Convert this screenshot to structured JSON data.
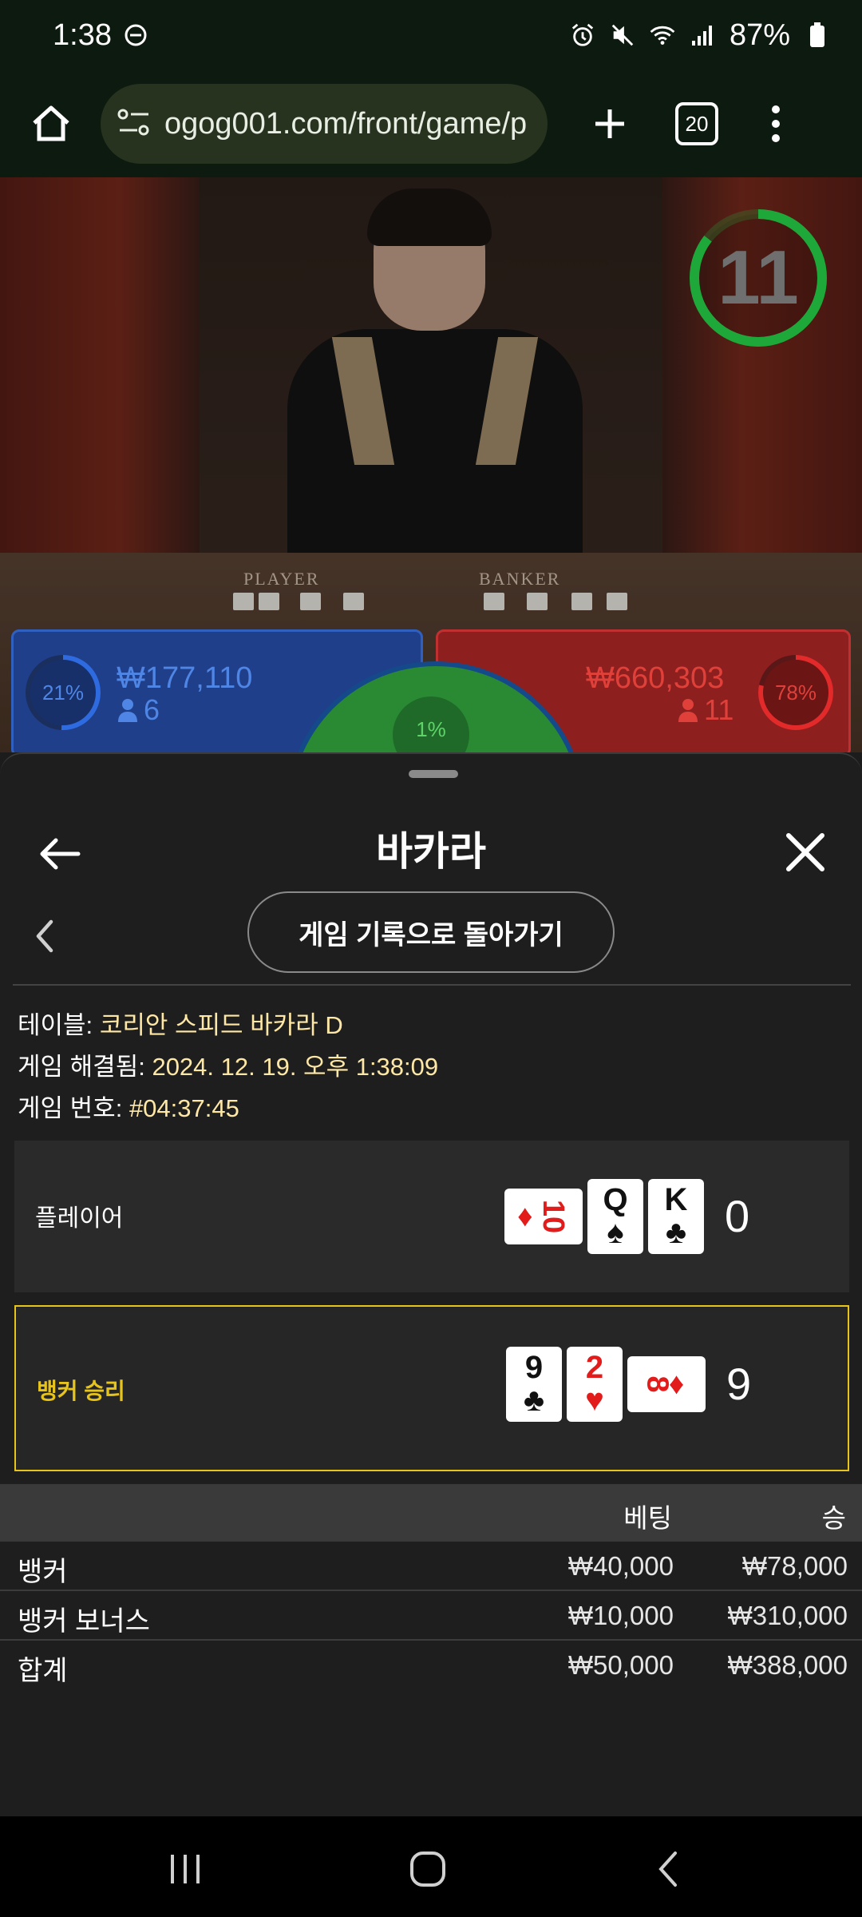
{
  "status_bar": {
    "time": "1:38",
    "battery": "87%"
  },
  "browser": {
    "url": "ogog001.com/front/game/p",
    "tab_count": "20"
  },
  "video": {
    "timer": "11",
    "player_label": "PLAYER",
    "banker_label": "BANKER"
  },
  "betting_board": {
    "player_pct": "21%",
    "player_amount": "₩177,110",
    "player_count": "6",
    "tie_pct": "1%",
    "banker_amount": "₩660,303",
    "banker_count": "11",
    "banker_pct": "78%"
  },
  "sheet": {
    "title": "바카라",
    "return_button": "게임 기록으로 돌아가기",
    "table_label": "테이블:",
    "table_value": "코리안 스피드 바카라 D",
    "resolved_label": "게임 해결됨:",
    "resolved_value": "2024. 12. 19. 오후 1:38:09",
    "game_no_label": "게임 번호:",
    "game_no_value": "#04:37:45"
  },
  "hands": {
    "player": {
      "label": "플레이어",
      "score": "0",
      "cards": [
        {
          "rank": "10",
          "suit": "♦",
          "color": "red",
          "side": true
        },
        {
          "rank": "Q",
          "suit": "♠",
          "color": "black",
          "side": false
        },
        {
          "rank": "K",
          "suit": "♣",
          "color": "black",
          "side": false
        }
      ]
    },
    "banker": {
      "label": "뱅커 승리",
      "score": "9",
      "cards": [
        {
          "rank": "9",
          "suit": "♣",
          "color": "black",
          "side": false
        },
        {
          "rank": "2",
          "suit": "♥",
          "color": "red",
          "side": false
        },
        {
          "rank": "8",
          "suit": "♦",
          "color": "red",
          "side": true
        }
      ]
    }
  },
  "bets": {
    "header_bet": "베팅",
    "header_win": "승",
    "rows": [
      {
        "name": "뱅커",
        "bet": "₩40,000",
        "win": "₩78,000"
      },
      {
        "name": "뱅커 보너스",
        "bet": "₩10,000",
        "win": "₩310,000"
      },
      {
        "name": "합계",
        "bet": "₩50,000",
        "win": "₩388,000"
      }
    ]
  },
  "colors": {
    "accent_gold": "#e7c41c",
    "info_text": "#ffe8a6",
    "player_blue": "#4f86e6",
    "banker_red": "#e0403a",
    "timer_green": "#1fa83a"
  }
}
